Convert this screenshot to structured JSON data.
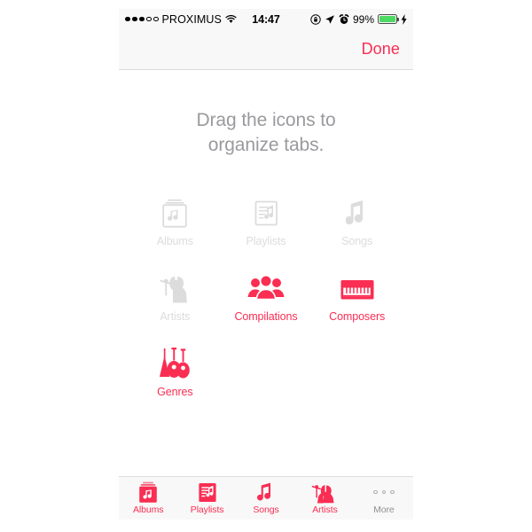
{
  "colors": {
    "accent": "#FA2D53",
    "disabled": "#DCDCDC",
    "headline_text": "#9A9A9E",
    "bar_background": "#F8F8F8",
    "battery_fill": "#4CD964",
    "inactive_tab": "#909095"
  },
  "status_bar": {
    "carrier": "PROXIMUS",
    "signal_filled_dots": 3,
    "signal_empty_dots": 2,
    "wifi_icon": "wifi-icon",
    "time": "14:47",
    "rotation_lock_icon": "rotation-lock-icon",
    "location_icon": "location-arrow-icon",
    "alarm_icon": "alarm-clock-icon",
    "battery_percent": "99%",
    "battery_icon": "battery-icon",
    "charging_icon": "lightning-bolt-icon"
  },
  "nav_bar": {
    "done_label": "Done"
  },
  "content": {
    "headline_line1": "Drag the icons to",
    "headline_line2": "organize tabs."
  },
  "grid": {
    "items": [
      {
        "label": "Albums",
        "icon": "albums-icon",
        "active": false
      },
      {
        "label": "Playlists",
        "icon": "playlists-icon",
        "active": false
      },
      {
        "label": "Songs",
        "icon": "songs-icon",
        "active": false
      },
      {
        "label": "Artists",
        "icon": "artists-icon",
        "active": false
      },
      {
        "label": "Compilations",
        "icon": "compilations-icon",
        "active": true
      },
      {
        "label": "Composers",
        "icon": "composers-icon",
        "active": true
      },
      {
        "label": "Genres",
        "icon": "genres-icon",
        "active": true
      }
    ]
  },
  "tab_bar": {
    "items": [
      {
        "label": "Albums",
        "icon": "albums-icon",
        "active": true
      },
      {
        "label": "Playlists",
        "icon": "playlists-icon",
        "active": true
      },
      {
        "label": "Songs",
        "icon": "songs-icon",
        "active": true
      },
      {
        "label": "Artists",
        "icon": "artists-icon",
        "active": true
      },
      {
        "label": "More",
        "icon": "more-dots-icon",
        "active": false
      }
    ]
  }
}
